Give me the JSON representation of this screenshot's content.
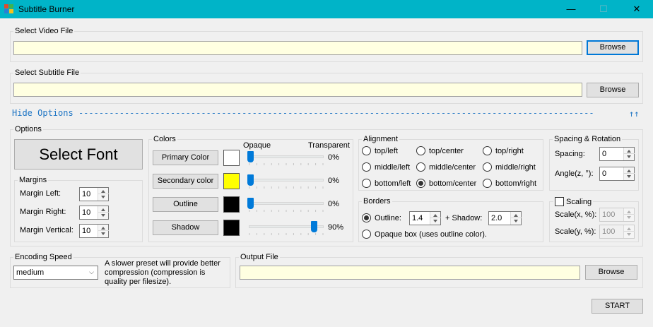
{
  "window": {
    "title": "Subtitle Burner",
    "minimize": "—",
    "maximize": "☐",
    "close": "✕"
  },
  "video": {
    "legend": "Select Video File",
    "value": "",
    "browse": "Browse"
  },
  "subtitle": {
    "legend": "Select Subtitle File",
    "value": "",
    "browse": "Browse"
  },
  "hide_options": {
    "text": "Hide Options",
    "dashes": "-----------------------------------------------------------------------------------------------------",
    "arrows": "↑↑"
  },
  "options": {
    "legend": "Options",
    "select_font": "Select Font",
    "margins": {
      "legend": "Margins",
      "left_label": "Margin Left:",
      "left_value": "10",
      "right_label": "Margin Right:",
      "right_value": "10",
      "vertical_label": "Margin Vertical:",
      "vertical_value": "10"
    },
    "colors": {
      "legend": "Colors",
      "opaque": "Opaque",
      "transparent": "Transparent",
      "rows": [
        {
          "label": "Primary Color",
          "color": "#ffffff",
          "opacity_pct": "0%",
          "transparency": 0
        },
        {
          "label": "Secondary color",
          "color": "#ffff00",
          "opacity_pct": "0%",
          "transparency": 0
        },
        {
          "label": "Outline",
          "color": "#000000",
          "opacity_pct": "0%",
          "transparency": 0
        },
        {
          "label": "Shadow",
          "color": "#000000",
          "opacity_pct": "90%",
          "transparency": 0.9
        }
      ]
    }
  },
  "alignment": {
    "legend": "Alignment",
    "options": [
      "top/left",
      "top/center",
      "top/right",
      "middle/left",
      "middle/center",
      "middle/right",
      "bottom/left",
      "bottom/center",
      "bottom/right"
    ],
    "selected": "bottom/center"
  },
  "borders": {
    "legend": "Borders",
    "outline_label": "Outline:",
    "outline_value": "1.4",
    "shadow_label": "+ Shadow:",
    "shadow_value": "2.0",
    "opaque_box": "Opaque box (uses outline color)."
  },
  "spacing": {
    "legend": "Spacing & Rotation",
    "spacing_label": "Spacing:",
    "spacing_value": "0",
    "angle_label": "Angle(z, °):",
    "angle_value": "0"
  },
  "scaling": {
    "label": "Scaling",
    "checked": false,
    "x_label": "Scale(x, %):",
    "x_value": "100",
    "y_label": "Scale(y, %):",
    "y_value": "100"
  },
  "encoding": {
    "legend": "Encoding Speed",
    "selected": "medium",
    "description": "A slower preset will provide better compression (compression is quality per filesize)."
  },
  "output": {
    "legend": "Output File",
    "value": "",
    "browse": "Browse"
  },
  "start": "START",
  "colors": {
    "titlebar": "#00b4c8",
    "path_bg": "#ffffe1",
    "link": "#1e75c4",
    "slider": "#007ad9"
  }
}
